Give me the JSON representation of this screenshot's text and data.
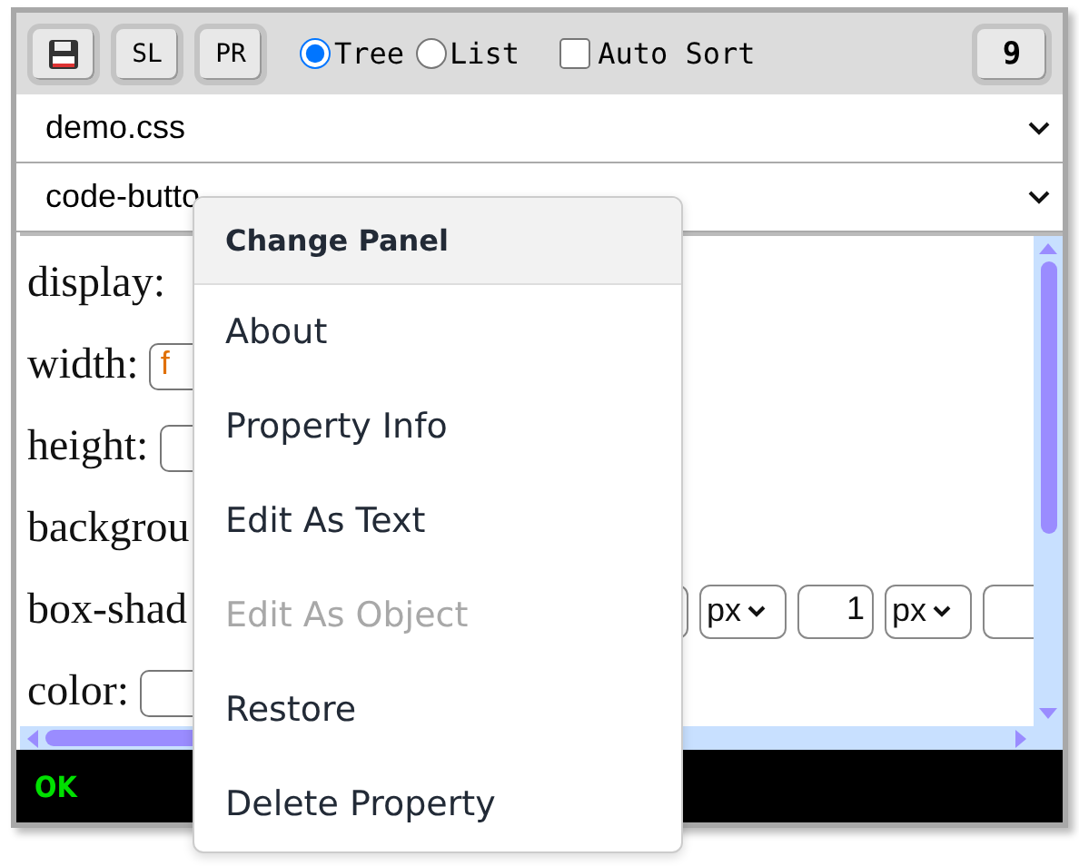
{
  "toolbar": {
    "buttons": [
      "SL",
      "PR"
    ],
    "view_modes": [
      {
        "label": "Tree",
        "selected": true
      },
      {
        "label": "List",
        "selected": false
      }
    ],
    "auto_sort": {
      "label": "Auto Sort",
      "checked": false
    },
    "count": "9"
  },
  "selectors": [
    "demo.css",
    "code-butto"
  ],
  "properties": [
    {
      "kind": "plain",
      "label": "display:"
    },
    {
      "kind": "field",
      "label": "width:",
      "value": "f"
    },
    {
      "kind": "field",
      "label": "height:"
    },
    {
      "kind": "plain",
      "label": "backgrou"
    },
    {
      "kind": "parts",
      "label": "box-shad",
      "parts": [
        {
          "kind": "input"
        },
        {
          "kind": "unit",
          "value": "px"
        },
        {
          "kind": "input",
          "value": "1"
        },
        {
          "kind": "unit",
          "value": "px"
        },
        {
          "kind": "input"
        }
      ]
    },
    {
      "kind": "field",
      "label": "color:"
    }
  ],
  "status": "OK",
  "context_menu": {
    "title": "Change Panel",
    "items": [
      {
        "label": "About",
        "disabled": false
      },
      {
        "label": "Property Info",
        "disabled": false
      },
      {
        "label": "Edit As Text",
        "disabled": false
      },
      {
        "label": "Edit As Object",
        "disabled": true
      },
      {
        "label": "Restore",
        "disabled": false
      },
      {
        "label": "Delete Property",
        "disabled": false
      }
    ]
  }
}
